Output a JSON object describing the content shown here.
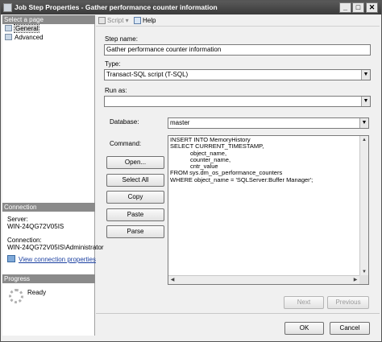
{
  "window": {
    "title": "Job Step Properties - Gather performance counter information"
  },
  "left_pane": {
    "select_page_header": "Select a page",
    "pages": [
      {
        "label": "General",
        "icon": "page-icon",
        "selected": true
      },
      {
        "label": "Advanced",
        "icon": "page-icon",
        "selected": false
      }
    ],
    "connection_header": "Connection",
    "server_label": "Server:",
    "server_value": "WIN-24QG72V05IS",
    "connection_label": "Connection:",
    "connection_value": "WIN-24QG72V05IS\\Administrator",
    "view_connection_link": "View connection properties",
    "progress_header": "Progress",
    "progress_status": "Ready"
  },
  "toolbar": {
    "script_label": "Script",
    "help_label": "Help"
  },
  "form": {
    "step_name_label": "Step name:",
    "step_name_value": "Gather performance counter information",
    "type_label": "Type:",
    "type_value": "Transact-SQL script (T-SQL)",
    "run_as_label": "Run as:",
    "run_as_value": "",
    "database_label": "Database:",
    "database_value": "master",
    "command_label": "Command:",
    "command_text": "INSERT INTO MemoryHistory\nSELECT CURRENT_TIMESTAMP,\n            object_name,\n            counter_name,\n            cntr_value\nFROM sys.dm_os_performance_counters\nWHERE object_name = 'SQLServer:Buffer Manager';"
  },
  "command_buttons": {
    "open": "Open...",
    "select_all": "Select All",
    "copy": "Copy",
    "paste": "Paste",
    "parse": "Parse"
  },
  "nav_buttons": {
    "next": "Next",
    "previous": "Previous"
  },
  "dialog_buttons": {
    "ok": "OK",
    "cancel": "Cancel"
  }
}
